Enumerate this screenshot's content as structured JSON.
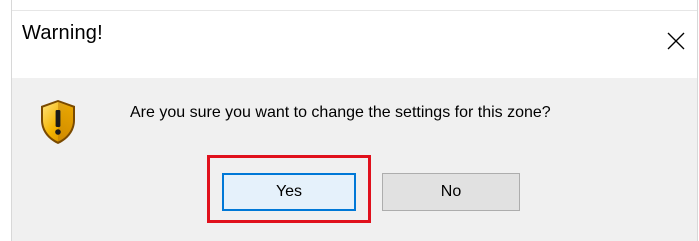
{
  "dialog": {
    "title": "Warning!",
    "message": "Are you sure you want to change the settings for this zone?",
    "icon": "shield-warning-icon",
    "close_icon": "close-icon",
    "buttons": {
      "yes_label": "Yes",
      "no_label": "No"
    }
  },
  "annotation": {
    "highlight_target": "yes-button",
    "highlight_color": "#e0101c"
  },
  "colors": {
    "content_background": "#f0f0f0",
    "default_button_border": "#0078d7",
    "default_button_fill": "#e5f1fb",
    "button_fill": "#e1e1e1"
  }
}
